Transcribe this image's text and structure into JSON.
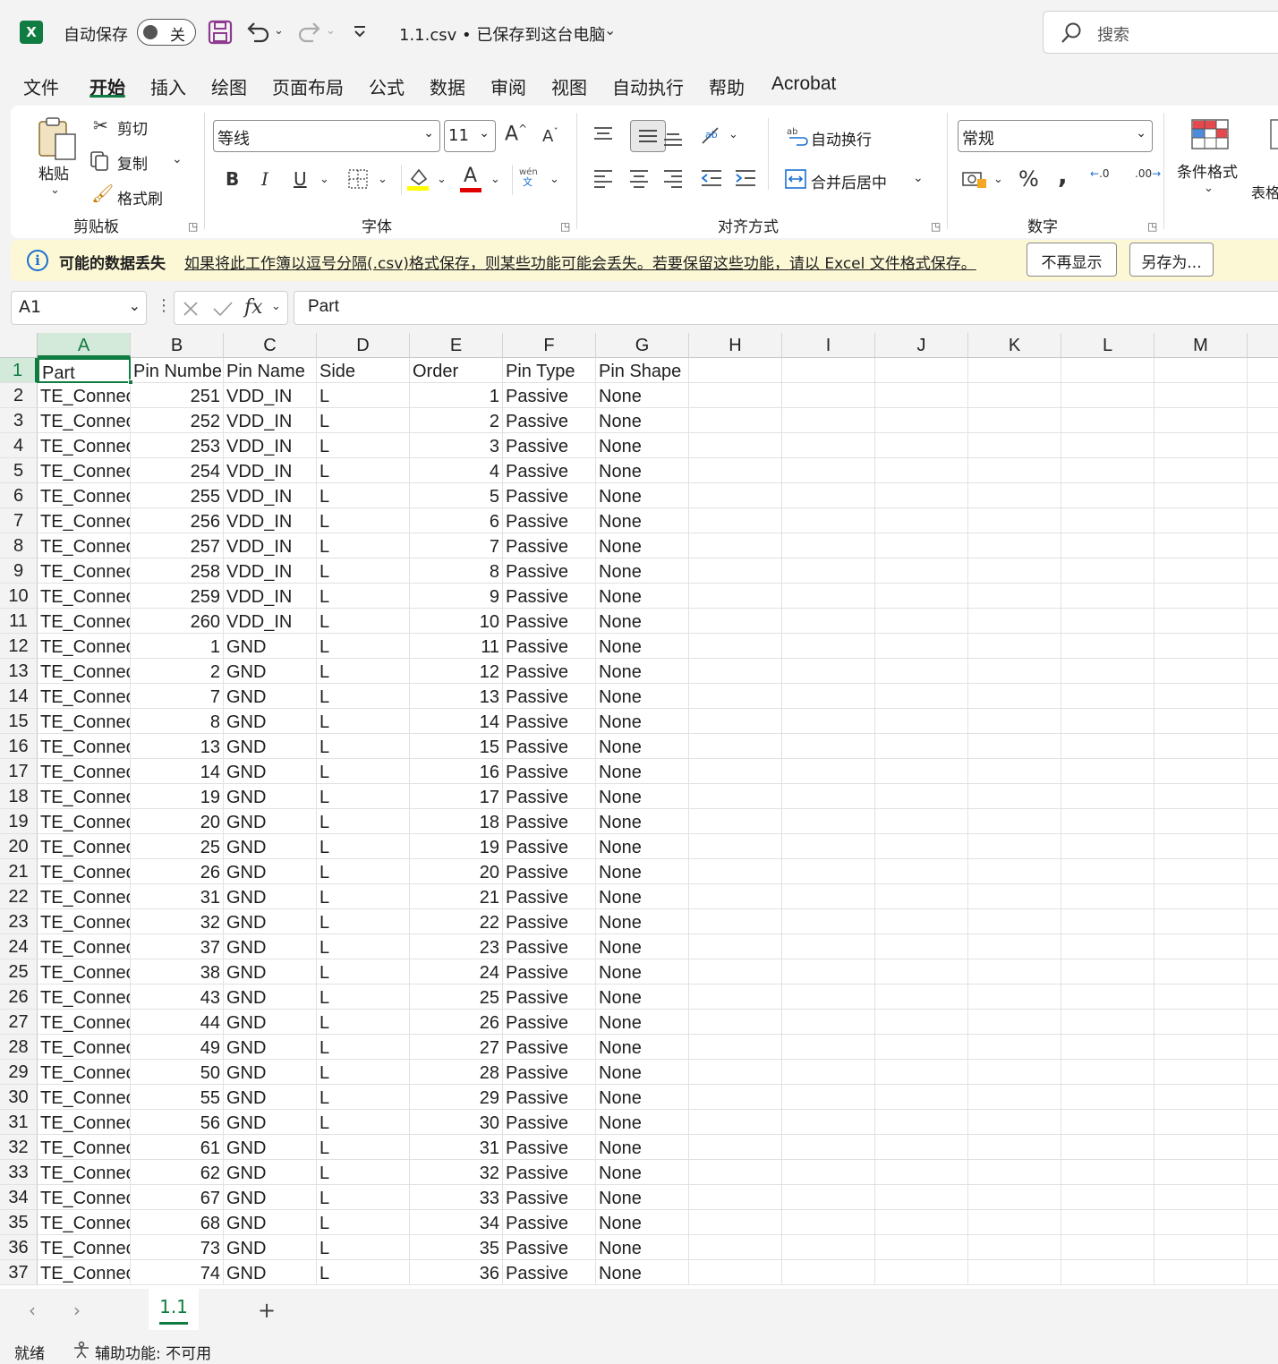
{
  "titlebar": {
    "logo": "X",
    "autosave_label": "自动保存",
    "autosave_state": "关",
    "file_title": "1.1.csv • 已保存到这台电脑",
    "search_placeholder": "搜索"
  },
  "menu": [
    "文件",
    "开始",
    "插入",
    "绘图",
    "页面布局",
    "公式",
    "数据",
    "审阅",
    "视图",
    "自动执行",
    "帮助",
    "Acrobat"
  ],
  "ribbon": {
    "clipboard": {
      "paste": "粘贴",
      "cut": "剪切",
      "copy": "复制",
      "format_painter": "格式刷",
      "label": "剪贴板"
    },
    "font": {
      "name": "等线",
      "size": "11",
      "bold": "B",
      "italic": "I",
      "underline": "U",
      "grow": "A",
      "shrink": "A",
      "phonetic": "wén",
      "phonetic_sub": "文",
      "color_a": "A",
      "label": "字体"
    },
    "alignment": {
      "wrap": "自动换行",
      "merge": "合并后居中",
      "label": "对齐方式"
    },
    "number": {
      "format": "常规",
      "percent": "%",
      "comma": ",",
      "inc": ".0",
      "dec": ".00",
      "label": "数字"
    },
    "styles": {
      "conditional": "条件格式",
      "table_partial": "表格"
    }
  },
  "message_bar": {
    "title": "可能的数据丢失",
    "text": "如果将此工作簿以逗号分隔(.csv)格式保存，则某些功能可能会丢失。若要保留这些功能，请以 Excel 文件格式保存。",
    "dont_show": "不再显示",
    "save_as": "另存为..."
  },
  "formula_bar": {
    "name_box": "A1",
    "fx": "fx",
    "value": "Part"
  },
  "sheet": {
    "columns": [
      "A",
      "B",
      "C",
      "D",
      "E",
      "F",
      "G",
      "H",
      "I",
      "J",
      "K",
      "L",
      "M"
    ],
    "header_row": [
      "Part",
      "Pin Number",
      "Pin Name",
      "Side",
      "Order",
      "Pin Type",
      "Pin Shape"
    ],
    "part_display": "TE_Connec",
    "rows": [
      [
        251,
        "VDD_IN",
        "L",
        1
      ],
      [
        252,
        "VDD_IN",
        "L",
        2
      ],
      [
        253,
        "VDD_IN",
        "L",
        3
      ],
      [
        254,
        "VDD_IN",
        "L",
        4
      ],
      [
        255,
        "VDD_IN",
        "L",
        5
      ],
      [
        256,
        "VDD_IN",
        "L",
        6
      ],
      [
        257,
        "VDD_IN",
        "L",
        7
      ],
      [
        258,
        "VDD_IN",
        "L",
        8
      ],
      [
        259,
        "VDD_IN",
        "L",
        9
      ],
      [
        260,
        "VDD_IN",
        "L",
        10
      ],
      [
        1,
        "GND",
        "L",
        11
      ],
      [
        2,
        "GND",
        "L",
        12
      ],
      [
        7,
        "GND",
        "L",
        13
      ],
      [
        8,
        "GND",
        "L",
        14
      ],
      [
        13,
        "GND",
        "L",
        15
      ],
      [
        14,
        "GND",
        "L",
        16
      ],
      [
        19,
        "GND",
        "L",
        17
      ],
      [
        20,
        "GND",
        "L",
        18
      ],
      [
        25,
        "GND",
        "L",
        19
      ],
      [
        26,
        "GND",
        "L",
        20
      ],
      [
        31,
        "GND",
        "L",
        21
      ],
      [
        32,
        "GND",
        "L",
        22
      ],
      [
        37,
        "GND",
        "L",
        23
      ],
      [
        38,
        "GND",
        "L",
        24
      ],
      [
        43,
        "GND",
        "L",
        25
      ],
      [
        44,
        "GND",
        "L",
        26
      ],
      [
        49,
        "GND",
        "L",
        27
      ],
      [
        50,
        "GND",
        "L",
        28
      ],
      [
        55,
        "GND",
        "L",
        29
      ],
      [
        56,
        "GND",
        "L",
        30
      ],
      [
        61,
        "GND",
        "L",
        31
      ],
      [
        62,
        "GND",
        "L",
        32
      ],
      [
        67,
        "GND",
        "L",
        33
      ],
      [
        68,
        "GND",
        "L",
        34
      ],
      [
        73,
        "GND",
        "L",
        35
      ],
      [
        74,
        "GND",
        "L",
        36
      ]
    ],
    "pin_type": "Passive",
    "pin_shape": "None"
  },
  "tabs": {
    "sheet": "1.1",
    "add": "+"
  },
  "status": {
    "ready": "就绪",
    "accessibility": "辅助功能: 不可用"
  },
  "colors": {
    "accent": "#107c41",
    "message_bg": "#fcf8d6"
  }
}
